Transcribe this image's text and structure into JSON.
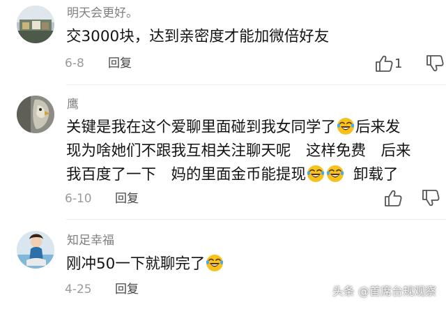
{
  "comments": [
    {
      "username": "明天会更好。",
      "lines": [
        [
          "交3000块，达到亲密度才能加微倍好友"
        ]
      ],
      "date": "6-8",
      "reply_label": "回复",
      "like_count": "1"
    },
    {
      "username": "鹰",
      "lines": [
        [
          "关键是我在这个爱聊里面碰到我女同学了",
          "后来发"
        ],
        [
          "现为啥她们不跟我互相关注聊天呢　这样免费　后来"
        ],
        [
          "我百度了一下　妈的里面金币能提现",
          "",
          "卸载了"
        ]
      ],
      "date": "6-10",
      "reply_label": "回复",
      "like_count": ""
    },
    {
      "username": "知足幸福",
      "lines": [
        [
          "刚冲50一下就聊完了",
          ""
        ]
      ],
      "date": "4-25",
      "reply_label": "回复",
      "like_count": ""
    }
  ],
  "icons": {
    "emoji": "face-with-tears-of-joy-icon",
    "like": "thumbs-up-icon",
    "dislike": "thumbs-down-icon"
  },
  "watermark": "头条 @首席台规观察",
  "colors": {
    "username": "#7f7f7f",
    "text": "#141414",
    "meta": "#9a9a9a",
    "emoji_face": "#f8c21c",
    "emoji_tears": "#4aa8ec"
  }
}
